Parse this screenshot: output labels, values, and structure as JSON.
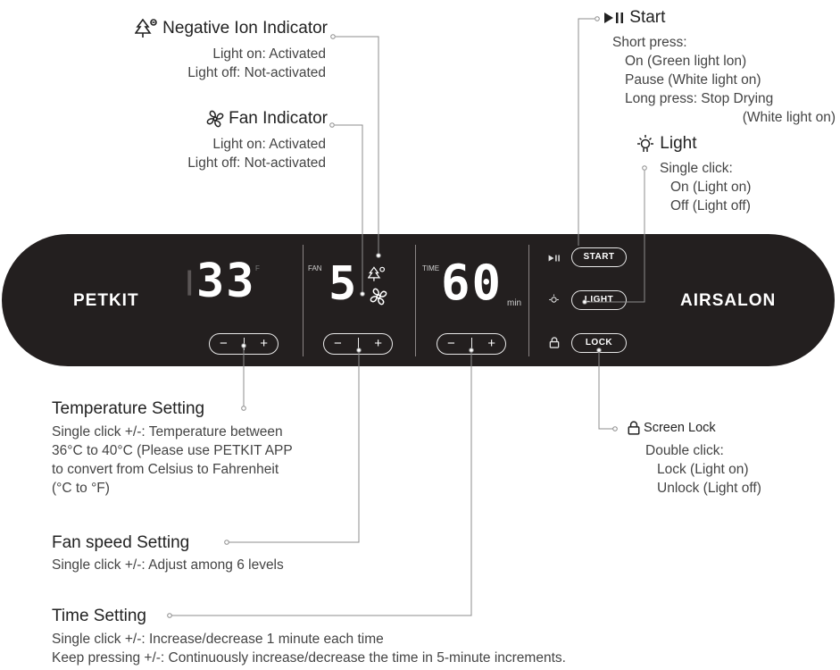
{
  "panel": {
    "brand_left": "PETKIT",
    "brand_right": "AIRSALON",
    "temp_display": "33",
    "temp_unit": "F",
    "fan_label": "FAN",
    "fan_display": "5",
    "time_label": "TIME",
    "time_display": "60",
    "time_unit": "min",
    "start_button": "START",
    "light_button": "LIGHT",
    "lock_button": "LOCK",
    "minus": "−",
    "plus": "+"
  },
  "callouts": {
    "negative_ion": {
      "title": "Negative Ion Indicator",
      "lines": [
        "Light on: Activated",
        "Light off: Not-activated"
      ]
    },
    "fan_indicator": {
      "title": "Fan Indicator",
      "lines": [
        "Light on: Activated",
        "Light off: Not-activated"
      ]
    },
    "start": {
      "title": "Start",
      "lines": [
        "Short press:",
        "On (Green light lon)",
        "Pause (White light on)",
        "Long press: Stop Drying",
        "(White light on)"
      ]
    },
    "light": {
      "title": "Light",
      "lines": [
        "Single click:",
        "On (Light on)",
        "Off (Light off)"
      ]
    },
    "temperature": {
      "title": "Temperature Setting",
      "lines": [
        "Single click +/-: Temperature between",
        "36°C to 40°C (Please use PETKIT APP",
        "to convert from Celsius to Fahrenheit",
        "(°C to °F)"
      ]
    },
    "fan_speed": {
      "title": "Fan speed Setting",
      "lines": [
        "Single click +/-: Adjust among 6 levels"
      ]
    },
    "time": {
      "title": "Time Setting",
      "lines": [
        "Single click +/-: Increase/decrease 1 minute each time",
        "Keep pressing +/-: Continuously increase/decrease the time in 5-minute increments."
      ]
    },
    "screen_lock": {
      "title": "Screen Lock",
      "lines": [
        "Double click:",
        "Lock (Light on)",
        "Unlock (Light off)"
      ]
    }
  },
  "icons": {
    "negative_ion": "tree-ion-icon",
    "fan": "fan-icon",
    "start": "play-pause-icon",
    "light": "bulb-icon",
    "lock": "lock-icon"
  }
}
